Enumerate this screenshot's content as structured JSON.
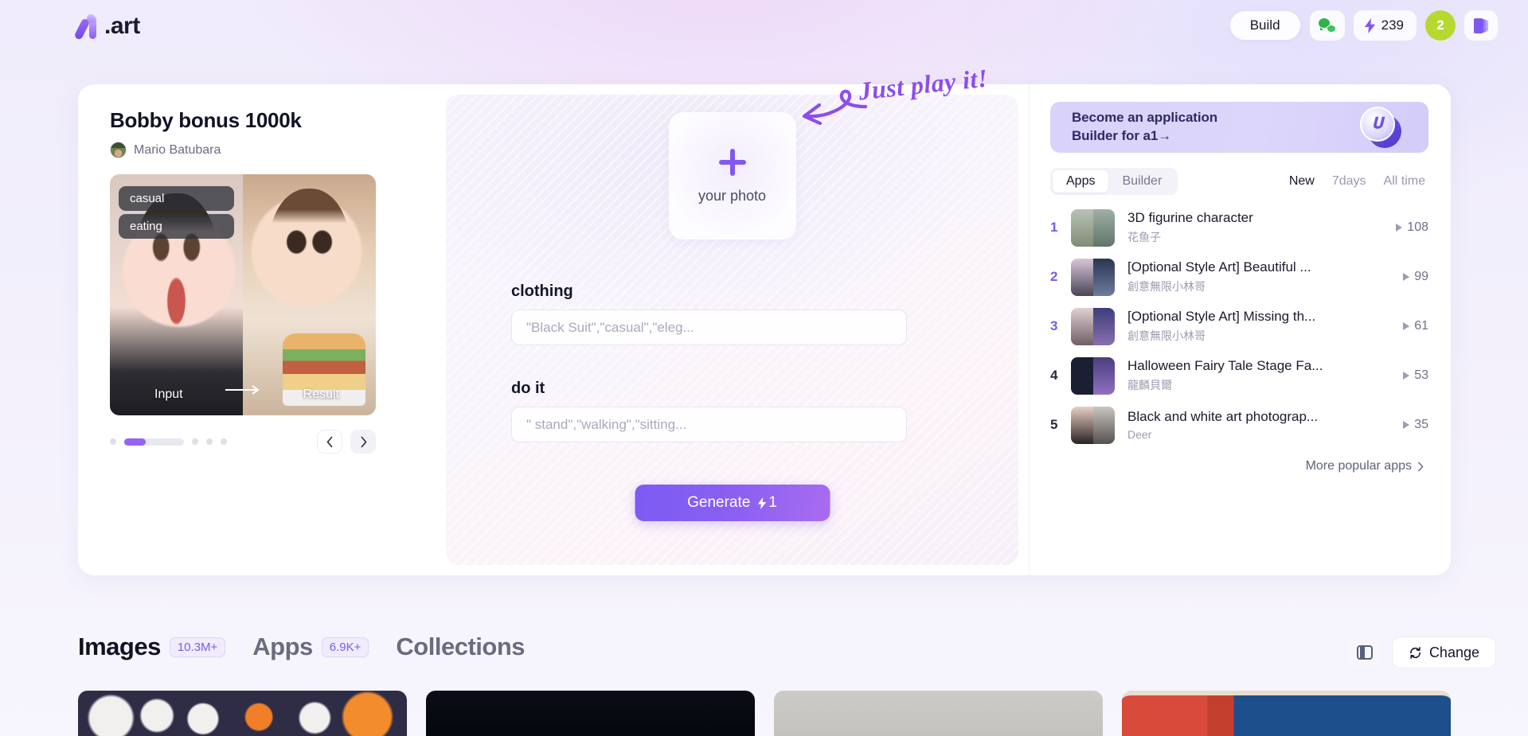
{
  "header": {
    "logo_text": ".art",
    "build_label": "Build",
    "wechat_icon": "wechat-icon",
    "credits": "239",
    "avatar_badge": "2",
    "book_icon": "book-icon"
  },
  "showcase": {
    "title": "Bobby bonus 1000k",
    "author": "Mario Batubara",
    "tags": [
      "casual",
      "eating"
    ],
    "input_label": "Input",
    "result_label": "Result"
  },
  "generator": {
    "upload_label": "your photo",
    "clothing_label": "clothing",
    "clothing_placeholder": "\"Black Suit\",\"casual\",\"eleg...",
    "clothing_value": "",
    "doit_label": "do it",
    "doit_placeholder": "\" stand\",\"walking\",\"sitting...",
    "doit_value": "",
    "generate_label": "Generate",
    "generate_cost": "1"
  },
  "annotation": {
    "text": "Just play it!",
    "color": "#8b4df0"
  },
  "rank_panel": {
    "promo": "Become an application\nBuilder for a1→",
    "tabs": [
      {
        "label": "Apps",
        "active": true
      },
      {
        "label": "Builder",
        "active": false
      }
    ],
    "filters": [
      {
        "label": "New",
        "active": true
      },
      {
        "label": "7days",
        "active": false
      },
      {
        "label": "All time",
        "active": false
      }
    ],
    "items": [
      {
        "rank": "1",
        "title": "3D figurine character",
        "author": "花鱼子",
        "plays": "108"
      },
      {
        "rank": "2",
        "title": "[Optional Style Art] Beautiful ...",
        "author": "創意無限小林哥",
        "plays": "99"
      },
      {
        "rank": "3",
        "title": "[Optional Style Art] Missing th...",
        "author": "創意無限小林哥",
        "plays": "61"
      },
      {
        "rank": "4",
        "title": "Halloween Fairy Tale Stage Fa...",
        "author": "龍麟貝爾",
        "plays": "53"
      },
      {
        "rank": "5",
        "title": "Black and white art photograp...",
        "author": "Deer",
        "plays": "35"
      }
    ],
    "more_link": "More popular apps"
  },
  "bottom": {
    "tabs": [
      {
        "label": "Images",
        "count": "10.3M+",
        "active": true
      },
      {
        "label": "Apps",
        "count": "6.9K+",
        "active": false
      },
      {
        "label": "Collections",
        "count": "",
        "active": false
      }
    ],
    "layout_icon": "split-layout-icon",
    "change_label": "Change"
  },
  "colors": {
    "accent_purple": "#8257f0",
    "badge_green": "#b6d930",
    "rank_number": "#7c5ae8"
  }
}
